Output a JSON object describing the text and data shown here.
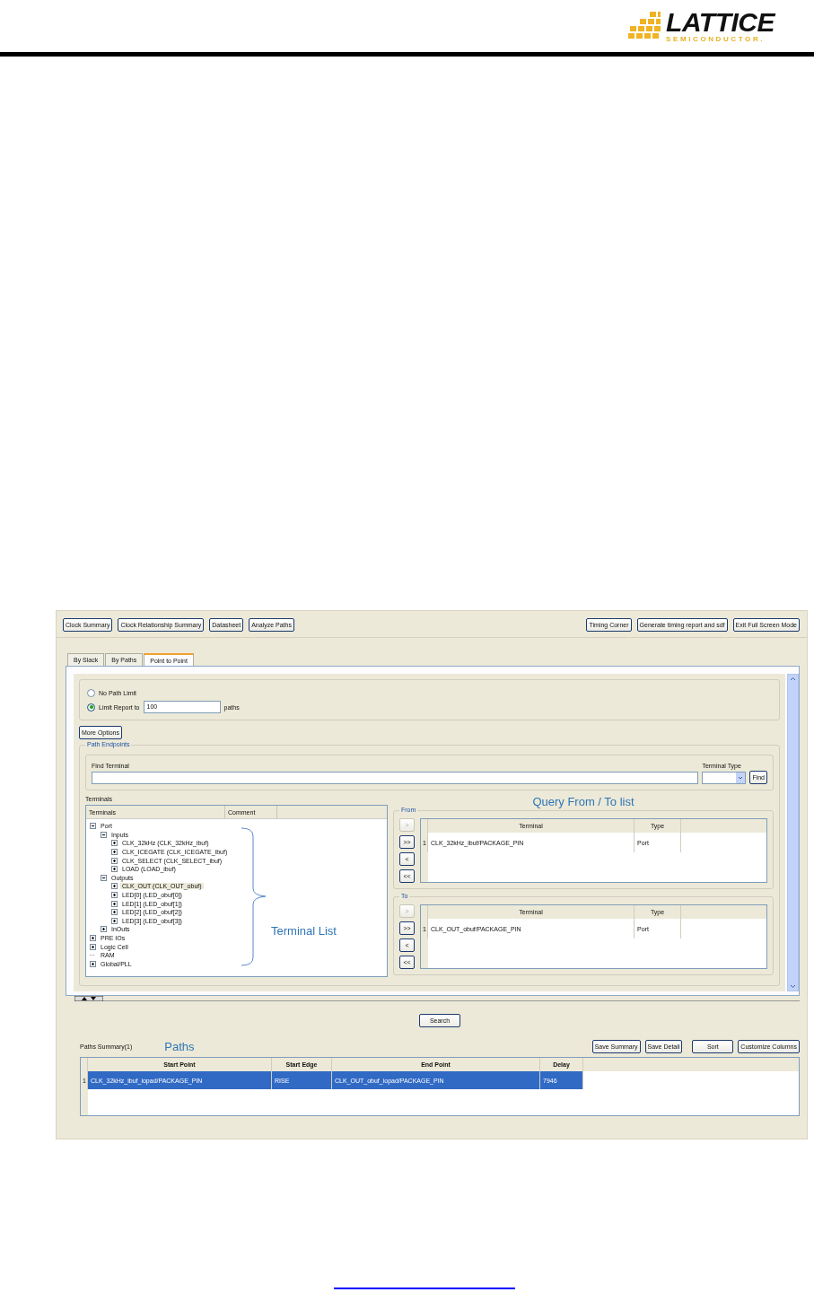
{
  "header": {
    "logo_word": "LATTICE",
    "logo_sub": "SEMICONDUCTOR."
  },
  "toolbar": {
    "left": [
      "Clock Summary",
      "Clock Relationship Summary",
      "Datasheet",
      "Analyze Paths"
    ],
    "right": [
      "Timing Corner",
      "Generate timing report and sdf",
      "Exit Full Screen Mode"
    ]
  },
  "tabs": [
    {
      "label": "By Slack",
      "selected": false
    },
    {
      "label": "By Paths",
      "selected": false
    },
    {
      "label": "Point to Point",
      "selected": true
    }
  ],
  "path_limit": {
    "options": [
      {
        "label": "No Path Limit",
        "selected": false
      },
      {
        "label": "Limit Report to",
        "selected": true
      }
    ],
    "value": "100",
    "suffix": "paths"
  },
  "more_options": "More Options",
  "path_endpoints": {
    "legend": "Path Endpoints",
    "find_label": "Find Terminal",
    "type_label": "Terminal Type",
    "find_button": "Find",
    "terminals_label": "Terminals",
    "tree_columns": [
      "Terminals",
      "Comment"
    ],
    "tree": [
      {
        "label": "Port",
        "expandable": true,
        "expanded": true,
        "selected": false,
        "children": [
          {
            "label": "Inputs",
            "expandable": true,
            "expanded": true,
            "selected": false,
            "children": [
              {
                "label": "CLK_32kHz (CLK_32kHz_ibuf)",
                "expandable": true,
                "expanded": false,
                "selected": false
              },
              {
                "label": "CLK_ICEGATE (CLK_ICEGATE_ibuf)",
                "expandable": true,
                "expanded": false,
                "selected": false
              },
              {
                "label": "CLK_SELECT (CLK_SELECT_ibuf)",
                "expandable": true,
                "expanded": false,
                "selected": false
              },
              {
                "label": "LOAD (LOAD_ibuf)",
                "expandable": true,
                "expanded": false,
                "selected": false
              }
            ]
          },
          {
            "label": "Outputs",
            "expandable": true,
            "expanded": true,
            "selected": false,
            "children": [
              {
                "label": "CLK_OUT (CLK_OUT_obuf)",
                "expandable": true,
                "expanded": false,
                "selected": true
              },
              {
                "label": "LED[0] (LED_obuf[0])",
                "expandable": true,
                "expanded": false,
                "selected": false
              },
              {
                "label": "LED[1] (LED_obuf[1])",
                "expandable": true,
                "expanded": false,
                "selected": false
              },
              {
                "label": "LED[2] (LED_obuf[2])",
                "expandable": true,
                "expanded": false,
                "selected": false
              },
              {
                "label": "LED[3] (LED_obuf[3])",
                "expandable": true,
                "expanded": false,
                "selected": false
              }
            ]
          },
          {
            "label": "InOuts",
            "expandable": true,
            "expanded": false,
            "selected": false
          }
        ]
      },
      {
        "label": "PRE IOs",
        "expandable": true,
        "expanded": false,
        "selected": false
      },
      {
        "label": "Logic Cell",
        "expandable": true,
        "expanded": false,
        "selected": false
      },
      {
        "label": "RAM",
        "expandable": false,
        "selected": false
      },
      {
        "label": "Global/PLL",
        "expandable": true,
        "expanded": false,
        "selected": false
      }
    ],
    "tree_annotation": "Terminal List",
    "query_annotation": "Query From / To list",
    "groups": [
      {
        "legend": "From",
        "buttons": [
          {
            "label": ">",
            "disabled": true
          },
          {
            "label": ">>",
            "disabled": false
          },
          {
            "label": "<",
            "disabled": false
          },
          {
            "label": "<<",
            "disabled": false
          }
        ],
        "columns": [
          "Terminal",
          "Type"
        ],
        "rows": [
          {
            "index": "1",
            "terminal": "CLK_32kHz_ibuf/PACKAGE_PIN",
            "type": "Port"
          }
        ]
      },
      {
        "legend": "To",
        "buttons": [
          {
            "label": ">",
            "disabled": true
          },
          {
            "label": ">>",
            "disabled": false
          },
          {
            "label": "<",
            "disabled": false
          },
          {
            "label": "<<",
            "disabled": false
          }
        ],
        "columns": [
          "Terminal",
          "Type"
        ],
        "rows": [
          {
            "index": "1",
            "terminal": "CLK_OUT_obuf/PACKAGE_PIN",
            "type": "Port"
          }
        ]
      }
    ]
  },
  "search_button": "Search",
  "paths": {
    "label": "Paths Summary(1)",
    "annotation": "Paths",
    "buttons": [
      "Save Summary",
      "Save Detail",
      "Sort",
      "Customize Columns"
    ],
    "columns": [
      "Start Point",
      "Start Edge",
      "End Point",
      "Delay"
    ],
    "rows": [
      {
        "index": "1",
        "cells": [
          "CLK_32kHz_ibuf_iopad/PACKAGE_PIN",
          "RISE",
          "CLK_OUT_obuf_iopad/PACKAGE_PIN",
          "7946"
        ],
        "selected": true
      }
    ]
  }
}
